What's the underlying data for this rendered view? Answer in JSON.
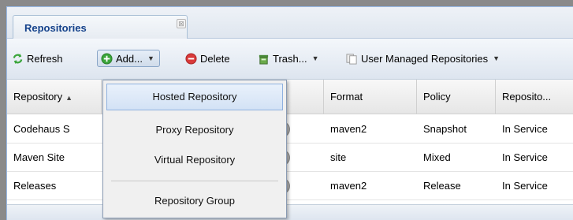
{
  "tab": {
    "title": "Repositories",
    "close_glyph": "⊠"
  },
  "toolbar": {
    "refresh": {
      "label": "Refresh",
      "icon": "refresh-icon"
    },
    "add": {
      "label": "Add...",
      "icon": "add-icon"
    },
    "delete": {
      "label": "Delete",
      "icon": "delete-icon"
    },
    "trash": {
      "label": "Trash...",
      "icon": "trash-icon"
    },
    "user_managed": {
      "label": "User Managed Repositories",
      "icon": "repositories-icon"
    }
  },
  "grid": {
    "columns": [
      "Repository",
      "Format",
      "Policy",
      "Reposito..."
    ],
    "rows": [
      {
        "name": "Codehaus S",
        "format": "maven2",
        "policy": "Snapshot",
        "status": "In Service"
      },
      {
        "name": "Maven Site",
        "format": "site",
        "policy": "Mixed",
        "status": "In Service"
      },
      {
        "name": "Releases",
        "format": "maven2",
        "policy": "Release",
        "status": "In Service"
      }
    ]
  },
  "add_menu": {
    "items": [
      "Hosted Repository",
      "Proxy Repository",
      "Virtual Repository",
      "Repository Group"
    ]
  },
  "colors": {
    "accent": "#15428b",
    "menu_highlight": "#d3e2f5",
    "add_green": "#3aa53a",
    "delete_red": "#d93a3a"
  }
}
